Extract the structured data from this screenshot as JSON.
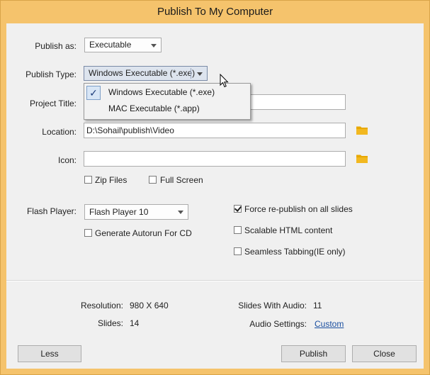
{
  "window": {
    "title": "Publish To My Computer"
  },
  "form": {
    "publish_as": {
      "label": "Publish as:",
      "value": "Executable"
    },
    "publish_type": {
      "label": "Publish Type:",
      "value": "Windows Executable (*.exe)",
      "options": [
        "Windows Executable (*.exe)",
        "MAC Executable (*.app)"
      ],
      "selected_index": 0
    },
    "project_title": {
      "label": "Project Title:",
      "value": ""
    },
    "location": {
      "label": "Location:",
      "value": "D:\\Sohail\\publish\\Video"
    },
    "icon": {
      "label": "Icon:",
      "value": ""
    },
    "zip_files": {
      "label": "Zip Files",
      "checked": false
    },
    "full_screen": {
      "label": "Full Screen",
      "checked": false
    },
    "flash_player": {
      "label": "Flash Player:",
      "value": "Flash Player 10"
    },
    "generate_autorun": {
      "label": "Generate Autorun For CD",
      "checked": false
    },
    "force_republish": {
      "label": "Force re-publish on all slides",
      "checked": true
    },
    "scalable_html": {
      "label": "Scalable HTML content",
      "checked": false
    },
    "seamless_tabbing": {
      "label": "Seamless Tabbing(IE only)",
      "checked": false
    }
  },
  "info": {
    "resolution_label": "Resolution:",
    "resolution_value": "980 X 640",
    "slides_label": "Slides:",
    "slides_value": "14",
    "slides_audio_label": "Slides With Audio:",
    "slides_audio_value": "11",
    "audio_settings_label": "Audio Settings:",
    "audio_settings_value": "Custom"
  },
  "buttons": {
    "less": "Less",
    "publish": "Publish",
    "close": "Close"
  },
  "icons": {
    "folder": "folder-icon",
    "checkmark": "checkmark-icon",
    "cursor": "mouse-pointer-icon"
  },
  "colors": {
    "title_bar": "#f5c36c",
    "client_bg": "#f0f0f0",
    "link": "#1a4fa0",
    "folder": "#e8a800"
  }
}
